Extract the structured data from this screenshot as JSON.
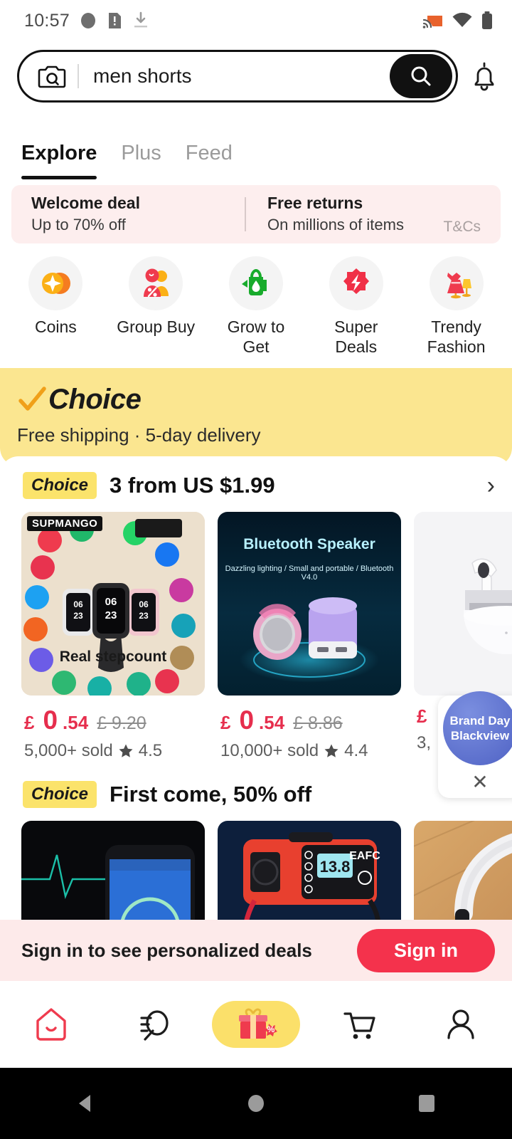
{
  "statusbar": {
    "time": "10:57",
    "left_icons": [
      "circle-icon",
      "sim-alert-icon",
      "download-icon"
    ],
    "right_icons": [
      "cast-icon",
      "wifi-icon",
      "battery-icon"
    ]
  },
  "search": {
    "camera_icon": "camera-search-icon",
    "value": "men shorts",
    "placeholder": "Search",
    "button_icon": "search-icon",
    "bell_icon": "notification-bell-icon"
  },
  "tabs": [
    {
      "label": "Explore",
      "active": true
    },
    {
      "label": "Plus",
      "active": false
    },
    {
      "label": "Feed",
      "active": false
    }
  ],
  "promo": {
    "left_title": "Welcome deal",
    "left_sub": "Up to 70% off",
    "right_title": "Free returns",
    "right_sub": "On millions of items",
    "terms": "T&Cs"
  },
  "categories": [
    {
      "label": "Coins",
      "icon": "coins-icon"
    },
    {
      "label": "Group Buy",
      "icon": "group-buy-icon"
    },
    {
      "label": "Grow to Get",
      "icon": "watering-can-icon"
    },
    {
      "label": "Super Deals",
      "icon": "lightning-badge-icon"
    },
    {
      "label": "Trendy Fashion",
      "icon": "dress-icon"
    }
  ],
  "choice_banner": {
    "logo_text": "Choice",
    "check_icon": "check-icon",
    "subtitle": "Free shipping  ·  5-day delivery"
  },
  "sections": [
    {
      "badge": "Choice",
      "title": "3 from US $1.99",
      "chevron": "›",
      "products": [
        {
          "name": "smartwatch-supmango",
          "brand_tag": "SUPMANGO",
          "caption": "Real stepcount",
          "currency": "£",
          "price_int": "0",
          "price_dec": ".54",
          "old_price": "£ 9.20",
          "sold": "5,000+ sold",
          "star_icon": "star-icon",
          "rating": "4.5"
        },
        {
          "name": "bluetooth-speaker",
          "title_overlay": "Bluetooth Speaker",
          "sub_overlay": "Dazzling lighting / Small and portable / Bluetooth V4.0",
          "currency": "£",
          "price_int": "0",
          "price_dec": ".54",
          "old_price": "£ 8.86",
          "sold": "10,000+ sold",
          "star_icon": "star-icon",
          "rating": "4.4"
        },
        {
          "name": "wireless-earbuds",
          "currency": "£",
          "price_int": "",
          "price_dec": "",
          "old_price": "",
          "sold": "3,",
          "star_icon": "star-icon",
          "rating": ""
        }
      ]
    },
    {
      "badge": "Choice",
      "title": "First  come, 50% off",
      "products": [
        {
          "name": "fitness-tracker-app"
        },
        {
          "name": "car-battery-charger-eafc",
          "brand_text": "EAFC",
          "display_value": "13.8"
        },
        {
          "name": "over-ear-headphones"
        }
      ]
    }
  ],
  "brand_ad": {
    "line1": "Brand Day",
    "line2": "Blackview",
    "close_icon": "close-icon"
  },
  "signin": {
    "message": "Sign in to see personalized deals",
    "button": "Sign in"
  },
  "bottomnav": [
    {
      "name": "home-icon",
      "label": "Home",
      "active": false
    },
    {
      "name": "feed-search-icon",
      "label": "Feed",
      "active": false
    },
    {
      "name": "gift-deals-icon",
      "label": "Deals",
      "active": true
    },
    {
      "name": "cart-icon",
      "label": "Cart",
      "active": false
    },
    {
      "name": "account-icon",
      "label": "Account",
      "active": false
    }
  ],
  "androidnav": [
    {
      "name": "back-button"
    },
    {
      "name": "home-button"
    },
    {
      "name": "recents-button"
    }
  ],
  "colors": {
    "brand_red": "#f4324c",
    "price_red": "#e62e4d",
    "choice_yellow": "#fbe690",
    "badge_yellow": "#fbe36b",
    "promo_pink": "#fdeeee",
    "signin_pink": "#fdeaea"
  }
}
